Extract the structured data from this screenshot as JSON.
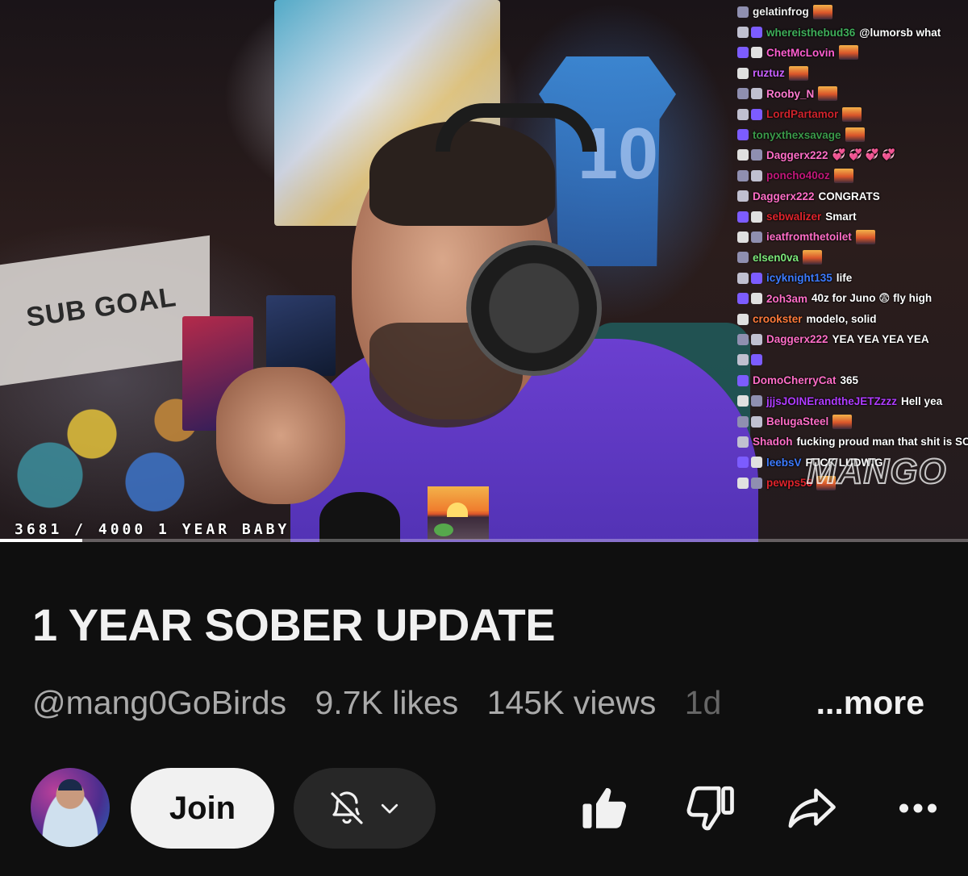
{
  "video": {
    "goal_overlay": "3681 / 4000 1 YEAR BABY",
    "watermark": "MANGO",
    "progress": 0.085,
    "chat": [
      {
        "user": "gelatinfrog",
        "color": "#f0f0f0",
        "message": "",
        "emote": true
      },
      {
        "user": "whereisthebud36",
        "color": "#3fae5a",
        "message": "@lumorsb what",
        "emote": false
      },
      {
        "user": "ChetMcLovin",
        "color": "#ff5fd1",
        "message": "",
        "emote": true
      },
      {
        "user": "ruztuz",
        "color": "#c860ff",
        "message": "",
        "emote": true
      },
      {
        "user": "Rooby_N",
        "color": "#ff7ad0",
        "message": "",
        "emote": true
      },
      {
        "user": "LordPartamor",
        "color": "#d0232c",
        "message": "",
        "emote": true
      },
      {
        "user": "tonyxthexsavage",
        "color": "#3b9a4a",
        "message": "",
        "emote": true
      },
      {
        "user": "Daggerx222",
        "color": "#ff6ec7",
        "message": "💞 💞 💞 💞",
        "emote": false
      },
      {
        "user": "poncho40oz",
        "color": "#c2187a",
        "message": "",
        "emote": true
      },
      {
        "user": "Daggerx222",
        "color": "#ff6ec7",
        "message": "CONGRATS",
        "emote": false
      },
      {
        "user": "sebwalizer",
        "color": "#e0242c",
        "message": "Smart",
        "emote": false
      },
      {
        "user": "ieatfromthetoilet",
        "color": "#ff6ec7",
        "message": "",
        "emote": true
      },
      {
        "user": "elsen0va",
        "color": "#7de87a",
        "message": "",
        "emote": true
      },
      {
        "user": "icyknight135",
        "color": "#3d7bff",
        "message": "life",
        "emote": false
      },
      {
        "user": "2oh3am",
        "color": "#ff6ec7",
        "message": "40z for Juno 😨 fly high",
        "emote": false
      },
      {
        "user": "crookster",
        "color": "#ff7a3a",
        "message": "modelo, solid",
        "emote": false
      },
      {
        "user": "Daggerx222",
        "color": "#ff6ec7",
        "message": "YEA YEA YEA YEA",
        "emote": false
      },
      {
        "user": "",
        "color": "#ffffff",
        "message": "",
        "emote": false
      },
      {
        "user": "DomoCherryCat",
        "color": "#ff6ec7",
        "message": "365",
        "emote": false
      },
      {
        "user": "jjjsJOINErandtheJETZzzz",
        "color": "#b03cff",
        "message": "Hell yea",
        "emote": false
      },
      {
        "user": "BelugaSteel",
        "color": "#ff6ec7",
        "message": "",
        "emote": true
      },
      {
        "user": "Shadoh",
        "color": "#ff6ec7",
        "message": "fucking proud man that shit is SO hard",
        "emote": false
      },
      {
        "user": "leebsV",
        "color": "#3d7bff",
        "message": "FUCK LUDWIG",
        "emote": false
      },
      {
        "user": "pewps56",
        "color": "#e0242c",
        "message": "",
        "emote": true
      }
    ]
  },
  "title": "1 YEAR SOBER UPDATE",
  "meta": {
    "channel": "@mang0GoBirds",
    "likes": "9.7K likes",
    "views": "145K views",
    "truncated": "1d",
    "more": "...more"
  },
  "actions": {
    "join": "Join",
    "icons": [
      "bell-off-icon",
      "chevron-down-icon",
      "like-icon",
      "dislike-icon",
      "share-icon",
      "more-icon"
    ]
  },
  "colors": {
    "background": "#0f0f0f",
    "join_bg": "#f1f1f1",
    "pill_bg": "#272727",
    "text_secondary": "#aaaaaa"
  }
}
